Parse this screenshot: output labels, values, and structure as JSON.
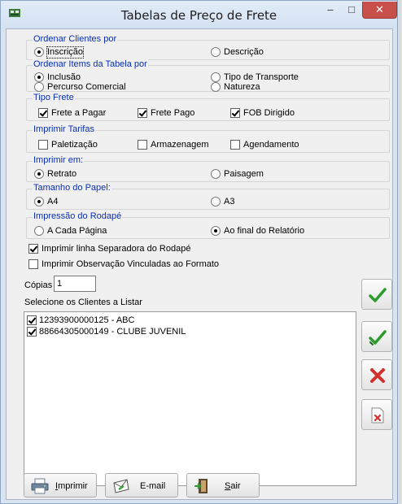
{
  "window": {
    "title": "Tabelas de Preço de Frete",
    "minimize": "–",
    "maximize": "□",
    "close": "✕"
  },
  "ordenar_clientes": {
    "legend": "Ordenar Clientes por",
    "options": [
      {
        "label": "Inscrição",
        "selected": true
      },
      {
        "label": "Descrição",
        "selected": false
      }
    ]
  },
  "ordenar_items": {
    "legend": "Ordenar Items da Tabela por",
    "options": [
      {
        "label": "Inclusão",
        "selected": true
      },
      {
        "label": "Tipo de Transporte",
        "selected": false
      },
      {
        "label": "Percurso Comercial",
        "selected": false
      },
      {
        "label": "Natureza",
        "selected": false
      }
    ]
  },
  "tipo_frete": {
    "legend": "Tipo Frete",
    "options": [
      {
        "label": "Frete a Pagar",
        "checked": true
      },
      {
        "label": "Frete Pago",
        "checked": true
      },
      {
        "label": "FOB Dirigido",
        "checked": true
      }
    ]
  },
  "imprimir_tarifas": {
    "legend": "Imprimir Tarifas",
    "options": [
      {
        "label": "Paletização",
        "checked": false
      },
      {
        "label": "Armazenagem",
        "checked": false
      },
      {
        "label": "Agendamento",
        "checked": false
      }
    ]
  },
  "imprimir_em": {
    "legend": "Imprimir em:",
    "options": [
      {
        "label": "Retrato",
        "selected": true
      },
      {
        "label": "Paisagem",
        "selected": false
      }
    ]
  },
  "tamanho_papel": {
    "legend": "Tamanho do Papel:",
    "options": [
      {
        "label": "A4",
        "selected": true
      },
      {
        "label": "A3",
        "selected": false
      }
    ]
  },
  "impressao_rodape": {
    "legend": "Impressão do Rodapé",
    "options": [
      {
        "label": "A Cada Página",
        "selected": false
      },
      {
        "label": "Ao final do Relatório",
        "selected": true
      }
    ]
  },
  "linha_separadora": {
    "label": "Imprimir linha Separadora do Rodapé",
    "checked": true
  },
  "observacao": {
    "label": "Imprimir Observação Vinculadas ao Formato",
    "checked": false
  },
  "copias": {
    "label": "Cópias",
    "value": "1"
  },
  "clientes": {
    "label": "Selecione os Clientes a Listar",
    "items": [
      {
        "label": "12393900000125 - ABC",
        "checked": true
      },
      {
        "label": "88664305000149 - CLUBE JUVENIL",
        "checked": true
      }
    ]
  },
  "side_buttons": [
    "check-single-icon",
    "check-all-icon",
    "uncheck-all-icon",
    "clear-icon"
  ],
  "buttons": {
    "imprimir_first": "I",
    "imprimir_rest": "mprimir",
    "email": "E-mail",
    "sair_first": "S",
    "sair_rest": "air"
  },
  "colors": {
    "legend": "#0b2fb0",
    "accent_green": "#2e9b2e",
    "accent_red": "#d2302c"
  }
}
